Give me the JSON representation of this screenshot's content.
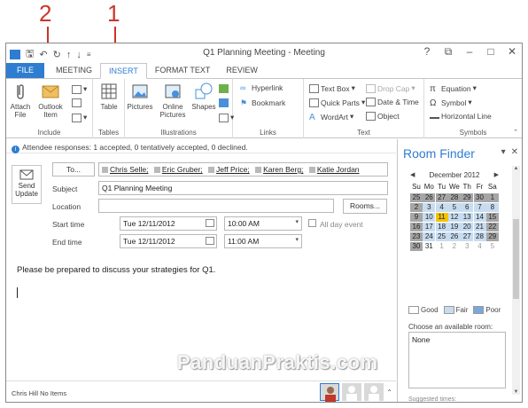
{
  "callouts": {
    "one": "1",
    "two": "2"
  },
  "window": {
    "title": "Q1 Planning Meeting - Meeting",
    "help": "?",
    "restore": "⧉",
    "minimize": "–",
    "maximize": "□",
    "close": "✕"
  },
  "tabs": [
    "FILE",
    "MEETING",
    "INSERT",
    "FORMAT TEXT",
    "REVIEW"
  ],
  "ribbon": {
    "include": {
      "label": "Include",
      "attach": "Attach File",
      "outlook_item": "Outlook Item"
    },
    "tables": {
      "table": "Table",
      "label": "Tables"
    },
    "illustrations": {
      "pictures": "Pictures",
      "online_pictures": "Online Pictures",
      "shapes": "Shapes",
      "label": "Illustrations"
    },
    "links": {
      "hyperlink": "Hyperlink",
      "bookmark": "Bookmark",
      "label": "Links"
    },
    "text": {
      "text_box": "Text Box",
      "quick_parts": "Quick Parts",
      "wordart": "WordArt",
      "drop_cap": "Drop Cap",
      "date_time": "Date & Time",
      "object": "Object",
      "label": "Text"
    },
    "symbols": {
      "equation": "Equation",
      "symbol": "Symbol",
      "horizontal_line": "Horizontal Line",
      "label": "Symbols"
    }
  },
  "info_bar": "Attendee responses: 1 accepted, 0 tentatively accepted, 0 declined.",
  "form": {
    "send_update": "Send Update",
    "to_button": "To...",
    "attendees": [
      "Chris Selle;",
      "Eric Gruber;",
      "Jeff Price;",
      "Karen Berg;",
      "Katie Jordan"
    ],
    "subject_label": "Subject",
    "subject_value": "Q1 Planning Meeting",
    "location_label": "Location",
    "location_value": "",
    "rooms_button": "Rooms...",
    "start_label": "Start time",
    "start_date": "Tue 12/11/2012",
    "start_time": "10:00 AM",
    "all_day": "All day event",
    "end_label": "End time",
    "end_date": "Tue 12/11/2012",
    "end_time": "11:00 AM"
  },
  "body_text": "Please be prepared to discuss your strategies for Q1.",
  "room_finder": {
    "title": "Room Finder",
    "month": "December 2012",
    "dow": [
      "Su",
      "Mo",
      "Tu",
      "We",
      "Th",
      "Fr",
      "Sa"
    ],
    "weeks": [
      [
        "25",
        "26",
        "27",
        "28",
        "29",
        "30",
        "1"
      ],
      [
        "2",
        "3",
        "4",
        "5",
        "6",
        "7",
        "8"
      ],
      [
        "9",
        "10",
        "11",
        "12",
        "13",
        "14",
        "15"
      ],
      [
        "16",
        "17",
        "18",
        "19",
        "20",
        "21",
        "22"
      ],
      [
        "23",
        "24",
        "25",
        "26",
        "27",
        "28",
        "29"
      ],
      [
        "30",
        "31",
        "1",
        "2",
        "3",
        "4",
        "5"
      ]
    ],
    "legend": {
      "good": "Good",
      "fair": "Fair",
      "poor": "Poor"
    },
    "choose_label": "Choose an available room:",
    "rooms": [
      "None"
    ],
    "suggested": "Suggested times:"
  },
  "status": {
    "text": "Chris Hill  No Items"
  },
  "watermark": "PanduanPraktis.com",
  "colors": {
    "accent": "#2e7dd1",
    "callout": "#c9362b",
    "selected_day": "#f2c300",
    "busy": "#c8dcf0",
    "weekend": "#a6a6a6"
  }
}
